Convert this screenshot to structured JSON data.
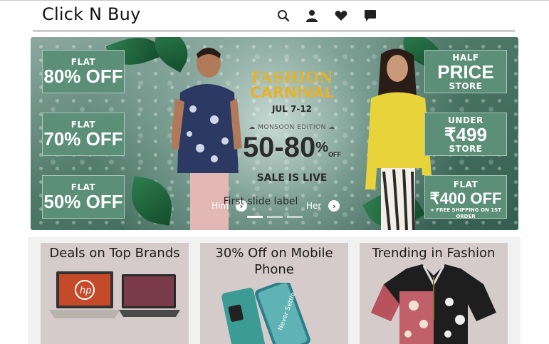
{
  "header": {
    "brand": "Click N Buy",
    "icons": [
      "search-icon",
      "user-icon",
      "heart-icon",
      "chat-icon"
    ]
  },
  "banner": {
    "left_offers": [
      {
        "small": "FLAT",
        "big": "80% OFF"
      },
      {
        "small": "FLAT",
        "big": "70% OFF"
      },
      {
        "small": "FLAT",
        "big": "50% OFF"
      }
    ],
    "right_offers": [
      {
        "small": "HALF",
        "big": "PRICE",
        "bottom": "STORE"
      },
      {
        "small": "UNDER",
        "big": "₹499",
        "bottom": "STORE"
      },
      {
        "small": "FLAT",
        "big": "₹400 OFF",
        "bottom": "+ FREE SHIPPING ON 1ST ORDER"
      }
    ],
    "center": {
      "line1": "FASHION",
      "line2": "CARNIVAL",
      "dates": "JUL 7-12",
      "edition": "MONSOON EDITION",
      "discount": "50-80",
      "discount_pct": "%",
      "discount_off": "OFF",
      "sale": "SALE IS LIVE"
    },
    "caption": "First slide label",
    "prev_label": "Him",
    "next_label": "Her",
    "slide_count": 3,
    "active_slide": 1
  },
  "cards": [
    {
      "title": "Deals on Top Brands"
    },
    {
      "title": "30% Off on Mobile Phone"
    },
    {
      "title": "Trending in Fashion"
    }
  ],
  "colors": {
    "offer_bg": "#5b8f78",
    "card_bg": "#d6cbcb",
    "accent_gold": "#e5b22a"
  }
}
